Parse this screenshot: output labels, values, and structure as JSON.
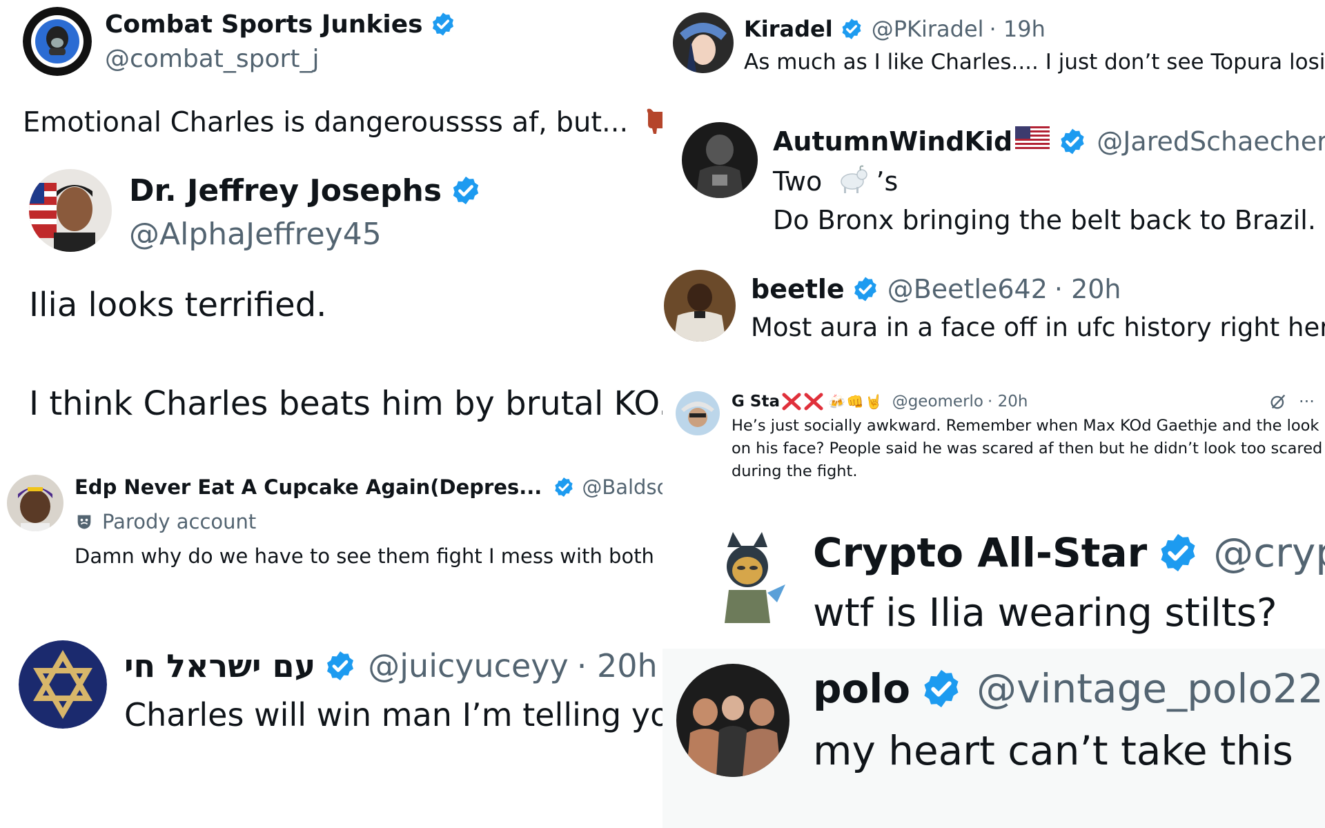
{
  "posts": [
    {
      "id": "combat",
      "name": "Combat Sports Junkies",
      "handle": "@combat_sport_j",
      "text": "Emotional Charles is dangeroussss af, but...",
      "emoji": "🐂"
    },
    {
      "id": "jeffrey",
      "name": "Dr. Jeffrey Josephs",
      "handle": "@AlphaJeffrey45",
      "text1": "Ilia looks terrified.",
      "text2": "I think Charles beats him by brutal KO."
    },
    {
      "id": "edp",
      "name": "Edp Never Eat A Cupcake Again(Depres...",
      "handle": "@BaldsonKe",
      "parody_label": "Parody account",
      "text": "Damn why do we have to see them fight I mess with both"
    },
    {
      "id": "israel",
      "name": "עם ישראל חי",
      "handle": "@juicyuceyy",
      "time": "· 20h",
      "text": "Charles will win man I’m telling you"
    },
    {
      "id": "kiradel",
      "name": "Kiradel",
      "handle": "@PKiradel",
      "time": "· 19h",
      "text": "As much as I like Charles.... I just don’t see Topura losing."
    },
    {
      "id": "autumn",
      "name": "AutumnWindKid",
      "handle": "@JaredSchaecher",
      "text1_pre": "Two",
      "text1_emoji": "🐐",
      "text1_post": "’s",
      "text2": "Do Bronx bringing the belt back to Brazil."
    },
    {
      "id": "beetle",
      "name": "beetle",
      "handle": "@Beetle642",
      "time": "· 20h",
      "text": "Most aura in a face off in ufc history right here"
    },
    {
      "id": "gsta",
      "name": "G Sta",
      "name_emojis": "🍻👊🤘",
      "handle": "@geomerlo",
      "time": "· 20h",
      "more": "···",
      "lines": [
        "He’s just socially awkward. Remember when Max KOd Gaethje and the look",
        "on his face? People said he was scared af then but he didn’t look too scared",
        "during the fight."
      ]
    },
    {
      "id": "crypto",
      "name": "Crypto All-Star",
      "handle": "@crypt",
      "text": "wtf is Ilia wearing stilts?"
    },
    {
      "id": "polo",
      "name": "polo",
      "handle": "@vintage_polo22",
      "time": "·",
      "text": "my heart can’t take this"
    }
  ],
  "colors": {
    "verified": "#1d9bf0",
    "text": "#0f1419",
    "secondary": "#536471",
    "polo_bg": "#f7f9f9"
  },
  "icons": [
    "verified-badge-icon",
    "parody-mask-icon",
    "grok-icon",
    "more-icon",
    "us-flag-icon",
    "x-mark-icon"
  ]
}
